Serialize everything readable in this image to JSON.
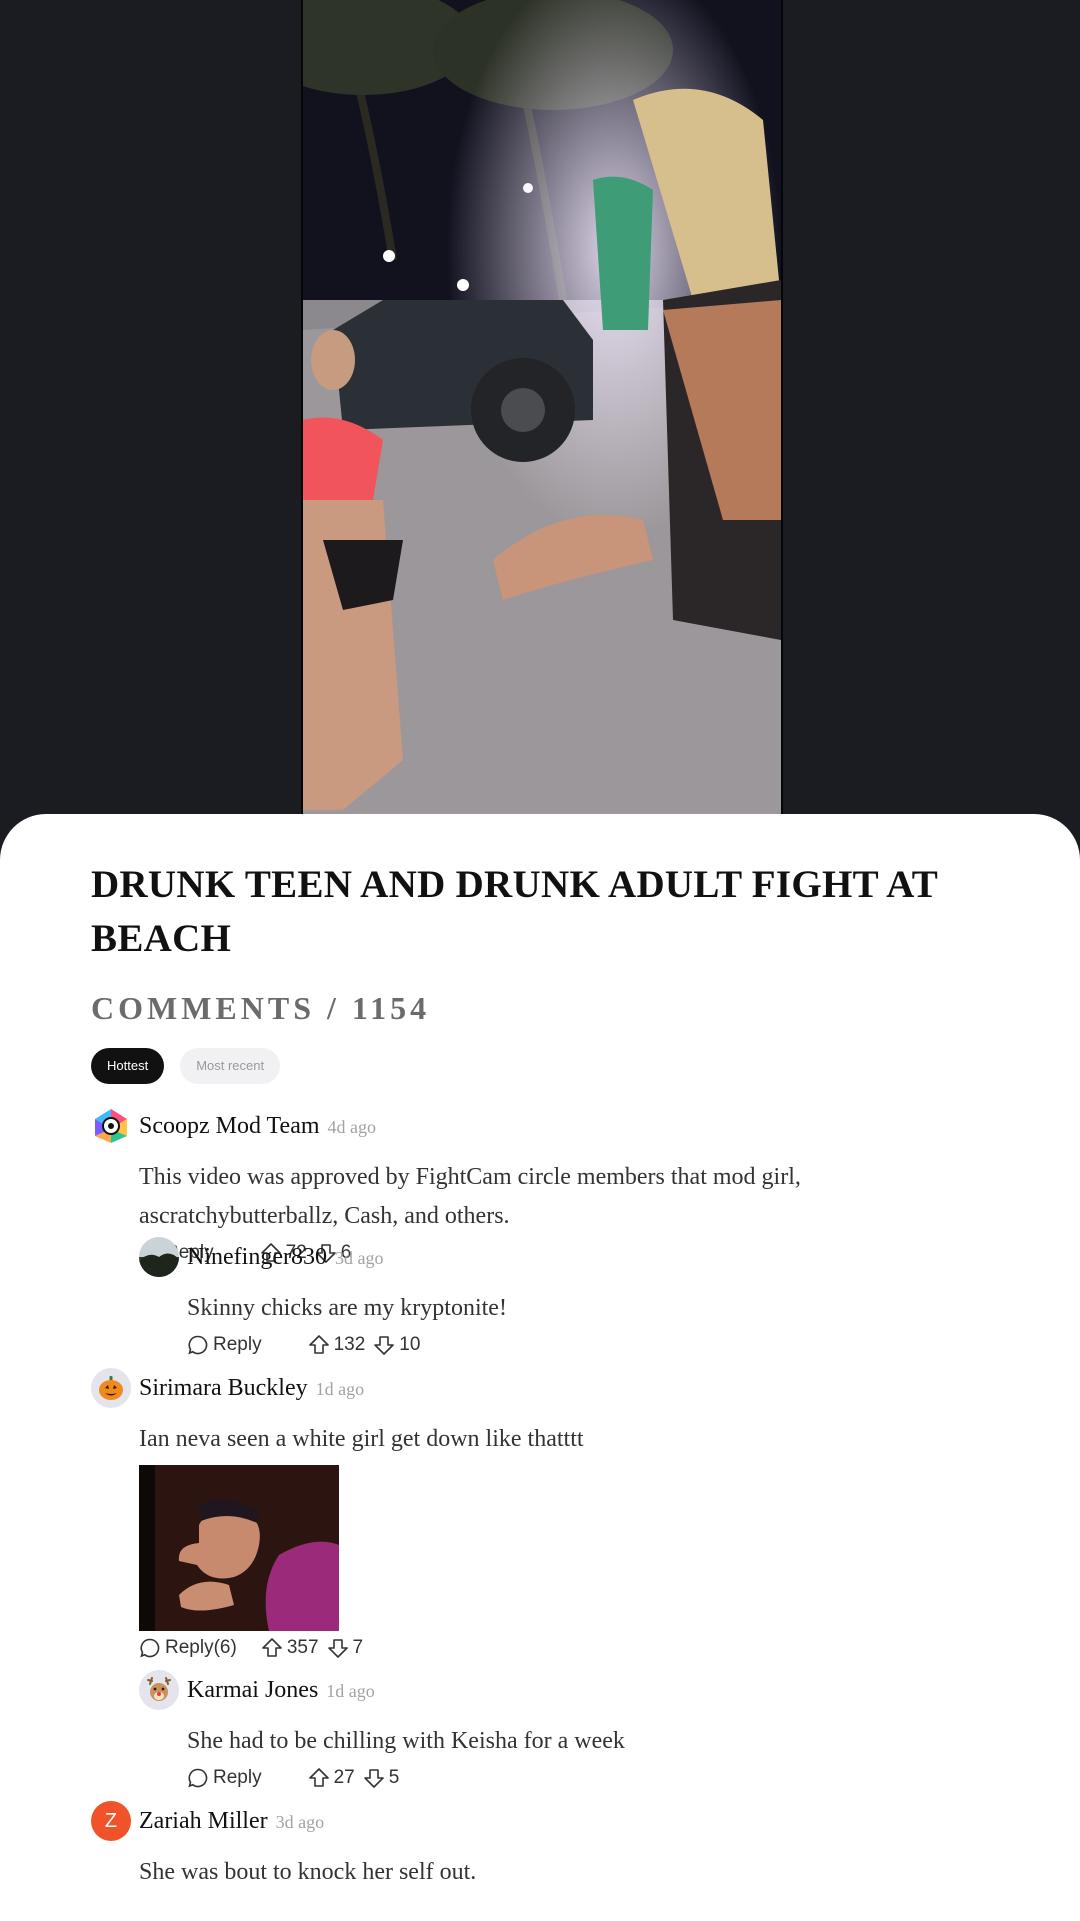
{
  "post": {
    "title": "DRUNK TEEN AND DRUNK ADULT FIGHT AT BEACH"
  },
  "comments_section": {
    "label": "COMMENTS",
    "separator": " / ",
    "count": "1154",
    "sort_tabs": [
      {
        "label": "Hottest",
        "active": true
      },
      {
        "label": "Most recent",
        "active": false
      }
    ]
  },
  "comments": [
    {
      "author": "Scoopz Mod Team",
      "time": "4d ago",
      "text": "This video was approved by FightCam circle members that mod girl, ascratchybutterballz, Cash, and others.",
      "reply_label": "Reply",
      "upvotes": "72",
      "downvotes": "6",
      "avatar_icon": "scoopz-logo-icon"
    },
    {
      "author": "Ninefinger830",
      "time": "3d ago",
      "text": "Skinny chicks are my kryptonite!",
      "reply_label": "Reply",
      "upvotes": "132",
      "downvotes": "10",
      "avatar_icon": "landscape-photo-avatar"
    },
    {
      "author": "Sirimara Buckley",
      "time": "1d ago",
      "text": "Ian neva seen a white girl get down like thatttt",
      "reply_label": "Reply(6)",
      "upvotes": "357",
      "downvotes": "7",
      "avatar_icon": "pumpkin-icon"
    },
    {
      "author": "Karmai Jones",
      "time": "1d ago",
      "text": "She had to be chilling with Keisha for a week",
      "reply_label": "Reply",
      "upvotes": "27",
      "downvotes": "5",
      "avatar_icon": "reindeer-icon"
    },
    {
      "author": "Zariah Miller",
      "time": "3d ago",
      "text": "She was bout to knock her self out.",
      "avatar_letter": "Z",
      "avatar_color": "#f0522a"
    }
  ],
  "colors": {
    "background_dark": "#1a1c22",
    "sheet": "#ffffff",
    "active_tab": "#111111",
    "muted_text": "#a2a2a2"
  }
}
